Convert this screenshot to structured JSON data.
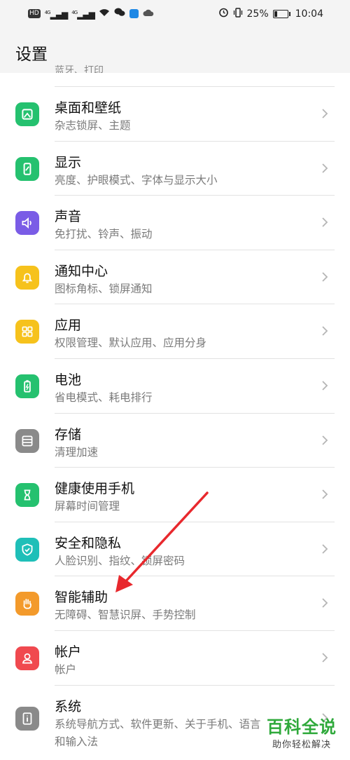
{
  "status_bar": {
    "hd": "HD",
    "net1": "4G",
    "net2": "4G",
    "battery_percent": "25%",
    "time": "10:04",
    "battery_level": 0.25,
    "icons": [
      "hd-icon",
      "signal-icon",
      "signal-icon",
      "wifi-icon",
      "wechat-icon",
      "app-icon",
      "cloud-icon",
      "alarm-icon",
      "vibrate-icon",
      "battery-icon"
    ]
  },
  "header": {
    "title": "设置"
  },
  "cut_row": {
    "sub": "蓝牙、打印"
  },
  "items": [
    {
      "title": "桌面和壁纸",
      "sub": "杂志锁屏、主题",
      "icon": "wallpaper-icon",
      "color": "#25c16f"
    },
    {
      "title": "显示",
      "sub": "亮度、护眼模式、字体与显示大小",
      "icon": "display-icon",
      "color": "#25c16f"
    },
    {
      "title": "声音",
      "sub": "免打扰、铃声、振动",
      "icon": "sound-icon",
      "color": "#7a5ce6"
    },
    {
      "title": "通知中心",
      "sub": "图标角标、锁屏通知",
      "icon": "notification-icon",
      "color": "#f6c21c"
    },
    {
      "title": "应用",
      "sub": "权限管理、默认应用、应用分身",
      "icon": "apps-icon",
      "color": "#f6c21c"
    },
    {
      "title": "电池",
      "sub": "省电模式、耗电排行",
      "icon": "battery-icon",
      "color": "#25c16f"
    },
    {
      "title": "存储",
      "sub": "清理加速",
      "icon": "storage-icon",
      "color": "#8a8a8a"
    },
    {
      "title": "健康使用手机",
      "sub": "屏幕时间管理",
      "icon": "hourglass-icon",
      "color": "#25c16f"
    },
    {
      "title": "安全和隐私",
      "sub": "人脸识别、指纹、锁屏密码",
      "icon": "shield-icon",
      "color": "#1fbfb8"
    },
    {
      "title": "智能辅助",
      "sub": "无障碍、智慧识屏、手势控制",
      "icon": "hand-icon",
      "color": "#f39a2b"
    },
    {
      "title": "帐户",
      "sub": "帐户",
      "icon": "account-icon",
      "color": "#f0494f"
    },
    {
      "title": "系统",
      "sub": "系统导航方式、软件更新、关于手机、语言和输入法",
      "icon": "system-icon",
      "color": "#8a8a8a"
    }
  ],
  "annotation": {
    "color": "#e8282d"
  },
  "watermark": {
    "title": "百科全说",
    "sub": "助你轻松解决"
  }
}
